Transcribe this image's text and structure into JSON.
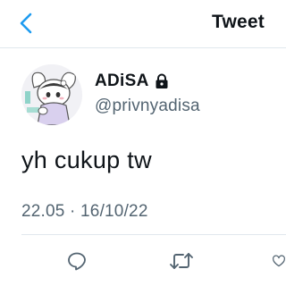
{
  "header": {
    "title": "Tweet",
    "back_icon": "chevron-left-icon"
  },
  "tweet": {
    "author": {
      "display_name": "ADiSA",
      "handle": "@privnyadisa",
      "protected_icon": "lock-icon",
      "avatar_icon": "cartoon-character-avatar"
    },
    "text": "yh cukup tw",
    "timestamp": "22.05 · 16/10/22"
  },
  "actions": [
    {
      "name": "reply",
      "icon": "reply-bubble-icon"
    },
    {
      "name": "retweet",
      "icon": "retweet-icon"
    },
    {
      "name": "like",
      "icon": "heart-icon"
    }
  ],
  "colors": {
    "accent": "#1d9bf0",
    "text_primary": "#0f1419",
    "text_secondary": "#536471",
    "divider": "#e1e8ed",
    "icon_gray": "#536471"
  }
}
